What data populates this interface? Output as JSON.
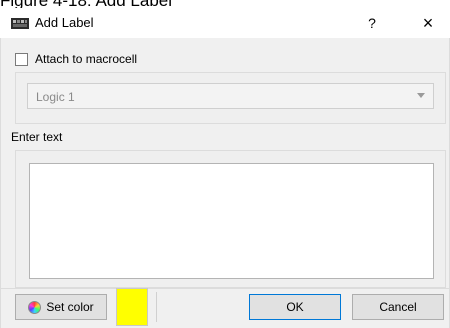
{
  "caption": "Figure 4-18: Add Label",
  "window": {
    "title": "Add Label",
    "help_label": "?",
    "close_label": "×"
  },
  "attach": {
    "label": "Attach to macrocell",
    "checked": false
  },
  "combo": {
    "value": "Logic 1"
  },
  "text_section": {
    "label": "Enter text",
    "value": ""
  },
  "buttons": {
    "set_color": "Set color",
    "ok": "OK",
    "cancel": "Cancel"
  },
  "colors": {
    "selected_swatch": "#ffff00",
    "ok_border": "#0078d7"
  }
}
